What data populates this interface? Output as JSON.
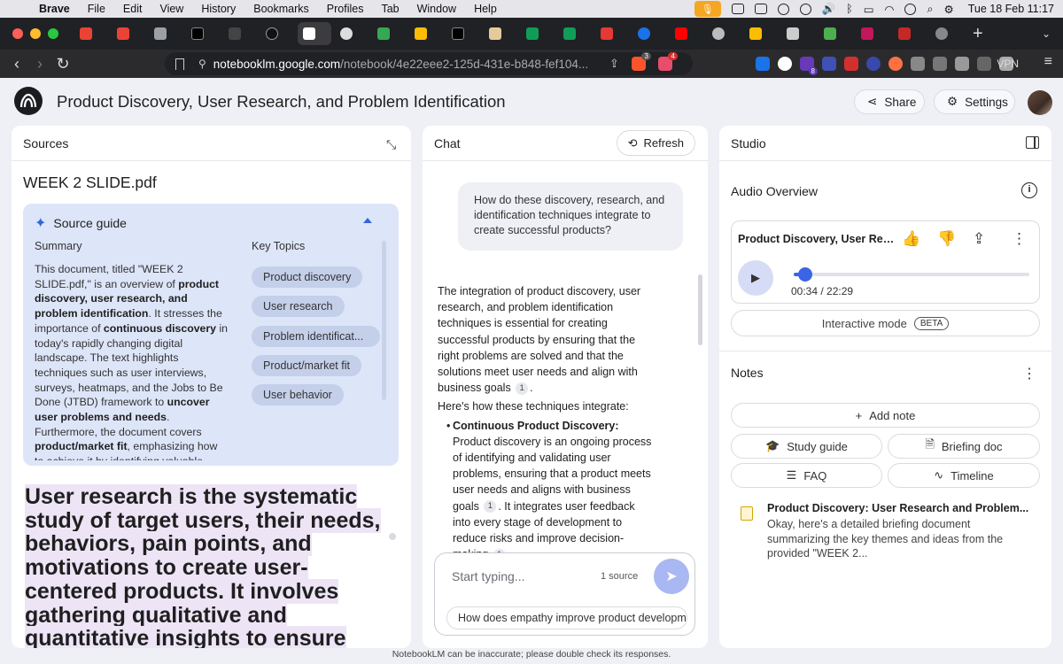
{
  "menubar": {
    "app": "Brave",
    "items": [
      "File",
      "Edit",
      "View",
      "History",
      "Bookmarks",
      "Profiles",
      "Tab",
      "Window",
      "Help"
    ],
    "clock": "Tue 18 Feb  11:17"
  },
  "browser": {
    "url_host": "notebooklm.google.com",
    "url_path": "/notebook/4e22eee2-125d-431e-b848-fef104...",
    "vpn_label": "VPN",
    "new_tab": "+",
    "brave_badge": "3",
    "rewards_badge": "4",
    "ext_badge": "8"
  },
  "header": {
    "title": "Product Discovery, User Research, and Problem Identification",
    "share_label": "Share",
    "settings_label": "Settings"
  },
  "sources": {
    "heading": "Sources",
    "doc_title": "WEEK 2 SLIDE.pdf",
    "guide": {
      "title": "Source guide",
      "summary_label": "Summary",
      "key_topics_label": "Key Topics",
      "topics": [
        "Product discovery",
        "User research",
        "Problem identificat...",
        "Product/market fit",
        "User behavior"
      ]
    },
    "quote": "User research is the systematic study of target users, their needs, behaviors, pain points, and motivations to create user-centered products. It involves gathering qualitative and quantitative insights to ensure that"
  },
  "chat": {
    "heading": "Chat",
    "refresh_label": "Refresh",
    "user_question": "How do these discovery, research, and identification techniques integrate to create successful products?",
    "composer_placeholder": "Start typing...",
    "source_count": "1 source",
    "suggestion": "How does empathy improve product developm"
  },
  "studio": {
    "heading": "Studio",
    "audio_overview_label": "Audio Overview",
    "audio_title": "Product Discovery, User Rese...",
    "time": "00:34 / 22:29",
    "progress": 0.025,
    "interactive_label": "Interactive mode",
    "beta_label": "BETA",
    "notes_label": "Notes",
    "add_note_label": "Add note",
    "study_guide_label": "Study guide",
    "briefing_label": "Briefing doc",
    "faq_label": "FAQ",
    "timeline_label": "Timeline",
    "note_title": "Product Discovery: User Research and Problem...",
    "note_body": "Okay, here's a detailed briefing document summarizing the key themes and ideas from the provided \"WEEK 2..."
  },
  "footer": "NotebookLM can be inaccurate; please double check its responses.",
  "colors": {
    "accent": "#3b64e6",
    "guide_bg": "#dde5f8",
    "chip_bg": "#c4cfea",
    "highlight": "#ede4f6"
  }
}
